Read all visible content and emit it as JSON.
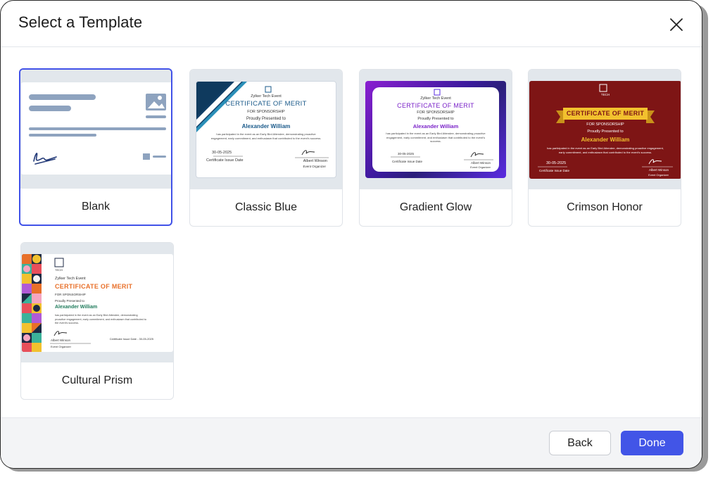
{
  "dialog": {
    "title": "Select a Template",
    "close_label": "Close"
  },
  "templates": [
    {
      "name": "Blank",
      "selected": true
    },
    {
      "name": "Classic Blue",
      "selected": false
    },
    {
      "name": "Gradient Glow",
      "selected": false
    },
    {
      "name": "Crimson Honor",
      "selected": false
    },
    {
      "name": "Cultural Prism",
      "selected": false
    }
  ],
  "certificate": {
    "event": "Zylker Tech Event",
    "heading": "CERTIFICATE OF MERIT",
    "sub": "FOR SPONSORSHIP",
    "presented": "Proudly Presented to",
    "recipient": "Alexander William",
    "body": "has participated in the event as an Early Bird Attendee, demonstrating proactive engagement, early commitment, and enthusiasm that contributed to the event's success.",
    "date": "30-05-2025",
    "date_label": "Certificate Issue Date",
    "date_inline": "Certificate Issue Date - 30-05-2025",
    "signer": "Albert Winson",
    "signer_role": "Event Organizer",
    "logo_text": "TECH"
  },
  "footer": {
    "back_label": "Back",
    "done_label": "Done"
  },
  "colors": {
    "accent": "#4255e7",
    "classic_blue": "#1a5a8a",
    "gradient_purple": "#6a1fd0",
    "crimson": "#7e1515",
    "gold": "#f2c12e",
    "prism_orange": "#e8702a"
  }
}
